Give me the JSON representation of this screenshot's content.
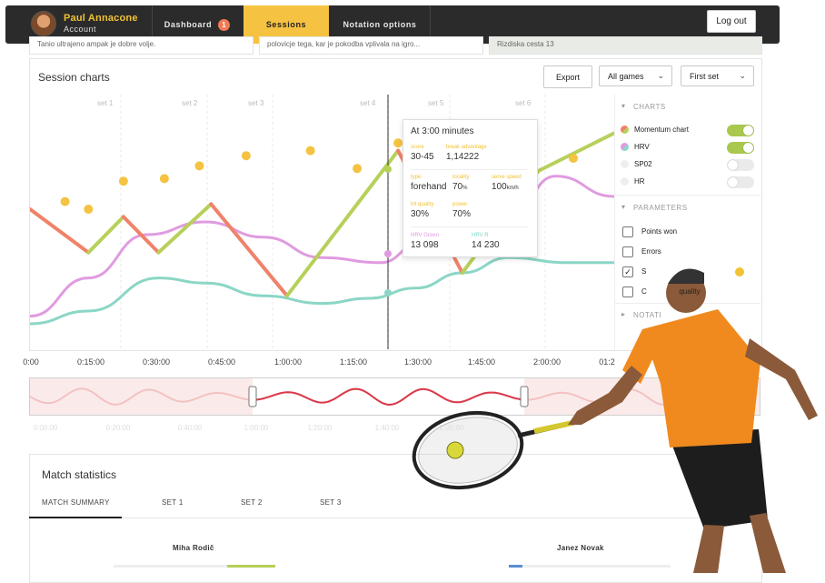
{
  "user": {
    "name": "Paul Annacone",
    "role": "Account"
  },
  "nav": {
    "dashboard": "Dashboard",
    "dashboard_badge": "1",
    "sessions": "Sessions",
    "notation": "Notation options",
    "logout": "Log out"
  },
  "peek": {
    "left": "Tanio ultrajeno ampak je dobre volje.",
    "middle": "polovicje tega, kar je pokodba vplivala na igro...",
    "right": "Rizdiska cesta 13"
  },
  "session_charts": {
    "title": "Session charts",
    "export": "Export",
    "games_select": "All games",
    "set_select": "First set"
  },
  "chart_data": {
    "type": "line",
    "x_unit": "time",
    "x_ticks": [
      "0:00",
      "0:15:00",
      "0:30:00",
      "0:45:00",
      "1:00:00",
      "1:15:00",
      "1:30:00",
      "1:45:00",
      "2:00:00",
      "01:2"
    ],
    "set_labels": [
      "set 1",
      "set 2",
      "set 3",
      "set 4",
      "set 5",
      "set 6"
    ],
    "cursor_time": "3:00 minutes",
    "series": [
      {
        "name": "Momentum chart",
        "color_low": "#f0826a",
        "color_high": "#b7d05a",
        "points": [
          [
            0,
            55
          ],
          [
            10,
            38
          ],
          [
            16,
            52
          ],
          [
            22,
            38
          ],
          [
            31,
            57
          ],
          [
            44,
            21
          ],
          [
            63,
            78
          ],
          [
            74,
            30
          ],
          [
            87,
            70
          ],
          [
            101,
            86
          ]
        ]
      },
      {
        "name": "HRV",
        "color": "#e09be0",
        "points": [
          [
            0,
            13
          ],
          [
            10,
            28
          ],
          [
            20,
            45
          ],
          [
            30,
            50
          ],
          [
            40,
            44
          ],
          [
            50,
            36
          ],
          [
            60,
            34
          ],
          [
            67,
            42
          ],
          [
            74,
            38
          ],
          [
            82,
            52
          ],
          [
            90,
            68
          ],
          [
            100,
            60
          ]
        ]
      },
      {
        "name": "Momentum baseline",
        "color": "#8bd6c6",
        "points": [
          [
            0,
            10
          ],
          [
            10,
            15
          ],
          [
            22,
            28
          ],
          [
            30,
            26
          ],
          [
            40,
            21
          ],
          [
            50,
            18
          ],
          [
            58,
            20
          ],
          [
            66,
            24
          ],
          [
            74,
            30
          ],
          [
            82,
            36
          ],
          [
            92,
            34
          ],
          [
            100,
            34
          ]
        ]
      }
    ],
    "events": [
      [
        6,
        58
      ],
      [
        10,
        55
      ],
      [
        16,
        66
      ],
      [
        23,
        67
      ],
      [
        29,
        72
      ],
      [
        37,
        76
      ],
      [
        48,
        78
      ],
      [
        56,
        71
      ],
      [
        63,
        81
      ],
      [
        74,
        66
      ],
      [
        80,
        69
      ],
      [
        93,
        75
      ]
    ]
  },
  "panel": {
    "charts_head": "CHARTS",
    "charts": [
      {
        "label": "Momentum chart",
        "on": true,
        "color": "#f0826a",
        "color2": "#b7d05a"
      },
      {
        "label": "HRV",
        "on": true,
        "color": "#e09be0",
        "color2": "#8bd6c6"
      },
      {
        "label": "SP02",
        "on": false,
        "color": "#eeeeee",
        "color2": "#eeeeee"
      },
      {
        "label": "HR",
        "on": false,
        "color": "#eeeeee",
        "color2": "#eeeeee"
      }
    ],
    "params_head": "PARAMETERS",
    "params": [
      {
        "label": "Points won",
        "checked": false
      },
      {
        "label": "Errors",
        "checked": false
      },
      {
        "label": "S",
        "checked": true
      },
      {
        "label": "C                quality",
        "checked": false
      }
    ],
    "notation_head": "NOTATI"
  },
  "tooltip": {
    "title": "At 3:00 minutes",
    "score_label": "score",
    "score": "30-45",
    "break_label": "break advantage",
    "break": "1,14222",
    "type_label": "type",
    "type": "forehand",
    "loc_label": "locality",
    "loc": "70",
    "speed_label": "serve speed",
    "speed": "100",
    "q_label": "hit quality",
    "q": "30%",
    "power_label": "power",
    "power": "70%",
    "hrv_green_label": "HRV Green",
    "hrv_green": "13 098",
    "hrv_r_label": "HRV R",
    "hrv_r": "14 230"
  },
  "timeline": {
    "ticks": [
      "0:00:00",
      "0:20:00",
      "0:40:00",
      "1:00:00",
      "1:20:00",
      "1:40:00",
      "2:00:00"
    ]
  },
  "stats": {
    "title": "Match statistics",
    "tabs": [
      "MATCH SUMMARY",
      "SET 1",
      "SET 2",
      "SET 3"
    ],
    "player_a": "Miha Rodič",
    "player_b": "Janez Novak"
  }
}
